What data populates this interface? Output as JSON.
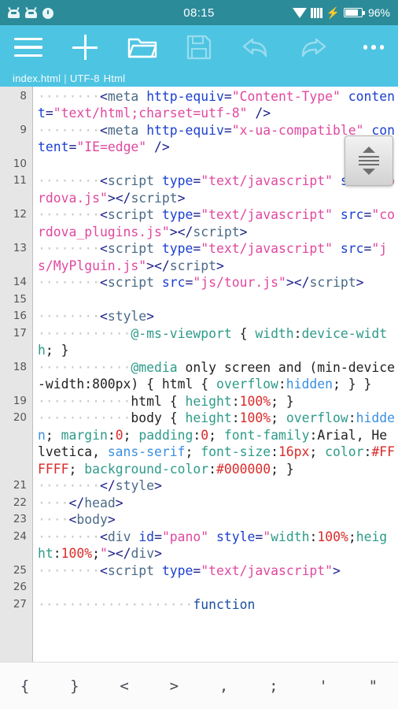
{
  "status_bar": {
    "clock": "08:15",
    "battery_percent": "96%",
    "left_icons": [
      "android-notification-icon",
      "android-notification-icon",
      "alarm-clock-icon"
    ],
    "right_icons": [
      "wifi-icon",
      "signal-bars-icon",
      "charging-bolt-icon",
      "battery-icon"
    ],
    "background_color": "#2c8b99"
  },
  "app_bar": {
    "background_color": "#4dc4e2",
    "buttons": [
      {
        "name": "menu-button",
        "icon": "hamburger-menu-icon",
        "enabled": true
      },
      {
        "name": "new-file-button",
        "icon": "plus-icon",
        "enabled": true
      },
      {
        "name": "open-file-button",
        "icon": "folder-open-icon",
        "enabled": true
      },
      {
        "name": "save-button",
        "icon": "floppy-disk-icon",
        "enabled": false
      },
      {
        "name": "undo-button",
        "icon": "undo-arrow-icon",
        "enabled": false
      },
      {
        "name": "redo-button",
        "icon": "redo-arrow-icon",
        "enabled": false
      },
      {
        "name": "overflow-menu-button",
        "icon": "more-dots-icon",
        "enabled": true
      }
    ],
    "file_info": {
      "filename": "index.html",
      "separator": "|",
      "encoding": "UTF-8",
      "language": "Html"
    }
  },
  "editor": {
    "first_visible_line": 8,
    "last_visible_line": 27,
    "gutter_color": "#e6e6e6",
    "scroll_handle": {
      "name": "scroll-handle",
      "up_icon": "triangle-up-icon",
      "grip_icon": "grip-lines-icon",
      "down_icon": "triangle-down-icon"
    },
    "lines": [
      {
        "number": "8",
        "tokens": [
          {
            "t": "ws",
            "s": "········"
          },
          {
            "t": "pun",
            "s": "<"
          },
          {
            "t": "tag",
            "s": "meta"
          },
          {
            "t": "txt",
            "s": " "
          },
          {
            "t": "attr",
            "s": "http-equiv"
          },
          {
            "t": "pun",
            "s": "="
          },
          {
            "t": "str",
            "s": "\"Content-Type\""
          },
          {
            "t": "txt",
            "s": " "
          },
          {
            "t": "attr",
            "s": "content"
          },
          {
            "t": "pun",
            "s": "="
          },
          {
            "t": "str",
            "s": "\"text/html;charset=utf-8\""
          },
          {
            "t": "txt",
            "s": " "
          },
          {
            "t": "pun",
            "s": "/>"
          }
        ]
      },
      {
        "number": "9",
        "tokens": [
          {
            "t": "ws",
            "s": "········"
          },
          {
            "t": "pun",
            "s": "<"
          },
          {
            "t": "tag",
            "s": "meta"
          },
          {
            "t": "txt",
            "s": " "
          },
          {
            "t": "attr",
            "s": "http-equiv"
          },
          {
            "t": "pun",
            "s": "="
          },
          {
            "t": "str",
            "s": "\"x-ua-compatible\""
          },
          {
            "t": "txt",
            "s": " "
          },
          {
            "t": "attr",
            "s": "content"
          },
          {
            "t": "pun",
            "s": "="
          },
          {
            "t": "str",
            "s": "\"IE=edge\""
          },
          {
            "t": "txt",
            "s": " "
          },
          {
            "t": "pun",
            "s": "/>"
          }
        ]
      },
      {
        "number": "10",
        "tokens": []
      },
      {
        "number": "11",
        "tokens": [
          {
            "t": "ws",
            "s": "········"
          },
          {
            "t": "pun",
            "s": "<"
          },
          {
            "t": "tag",
            "s": "script"
          },
          {
            "t": "txt",
            "s": " "
          },
          {
            "t": "attr",
            "s": "type"
          },
          {
            "t": "pun",
            "s": "="
          },
          {
            "t": "str",
            "s": "\"text/javascript\""
          },
          {
            "t": "txt",
            "s": " "
          },
          {
            "t": "attr",
            "s": "src"
          },
          {
            "t": "pun",
            "s": "="
          },
          {
            "t": "str",
            "s": "\"cordova.js\""
          },
          {
            "t": "pun",
            "s": ">"
          },
          {
            "t": "pun",
            "s": "</"
          },
          {
            "t": "tag",
            "s": "script"
          },
          {
            "t": "pun",
            "s": ">"
          }
        ]
      },
      {
        "number": "12",
        "tokens": [
          {
            "t": "ws",
            "s": "········"
          },
          {
            "t": "pun",
            "s": "<"
          },
          {
            "t": "tag",
            "s": "script"
          },
          {
            "t": "txt",
            "s": " "
          },
          {
            "t": "attr",
            "s": "type"
          },
          {
            "t": "pun",
            "s": "="
          },
          {
            "t": "str",
            "s": "\"text/javascript\""
          },
          {
            "t": "txt",
            "s": " "
          },
          {
            "t": "attr",
            "s": "src"
          },
          {
            "t": "pun",
            "s": "="
          },
          {
            "t": "str",
            "s": "\"cordova_plugins.js\""
          },
          {
            "t": "pun",
            "s": ">"
          },
          {
            "t": "pun",
            "s": "</"
          },
          {
            "t": "tag",
            "s": "script"
          },
          {
            "t": "pun",
            "s": ">"
          }
        ]
      },
      {
        "number": "13",
        "tokens": [
          {
            "t": "ws",
            "s": "········"
          },
          {
            "t": "pun",
            "s": "<"
          },
          {
            "t": "tag",
            "s": "script"
          },
          {
            "t": "txt",
            "s": " "
          },
          {
            "t": "attr",
            "s": "type"
          },
          {
            "t": "pun",
            "s": "="
          },
          {
            "t": "str",
            "s": "\"text/javascript\""
          },
          {
            "t": "txt",
            "s": " "
          },
          {
            "t": "attr",
            "s": "src"
          },
          {
            "t": "pun",
            "s": "="
          },
          {
            "t": "str",
            "s": "\"js/MyPlguin.js\""
          },
          {
            "t": "pun",
            "s": ">"
          },
          {
            "t": "pun",
            "s": "</"
          },
          {
            "t": "tag",
            "s": "script"
          },
          {
            "t": "pun",
            "s": ">"
          }
        ]
      },
      {
        "number": "14",
        "tokens": [
          {
            "t": "ws",
            "s": "········"
          },
          {
            "t": "pun",
            "s": "<"
          },
          {
            "t": "tag",
            "s": "script"
          },
          {
            "t": "txt",
            "s": " "
          },
          {
            "t": "attr",
            "s": "src"
          },
          {
            "t": "pun",
            "s": "="
          },
          {
            "t": "str",
            "s": "\"js/tour.js\""
          },
          {
            "t": "pun",
            "s": ">"
          },
          {
            "t": "pun",
            "s": "</"
          },
          {
            "t": "tag",
            "s": "script"
          },
          {
            "t": "pun",
            "s": ">"
          }
        ]
      },
      {
        "number": "15",
        "tokens": []
      },
      {
        "number": "16",
        "tokens": [
          {
            "t": "ws",
            "s": "········"
          },
          {
            "t": "pun",
            "s": "<"
          },
          {
            "t": "tag",
            "s": "style"
          },
          {
            "t": "pun",
            "s": ">"
          }
        ]
      },
      {
        "number": "17",
        "tokens": [
          {
            "t": "ws",
            "s": "············"
          },
          {
            "t": "at",
            "s": "@-ms-viewport"
          },
          {
            "t": "txt",
            "s": " { "
          },
          {
            "t": "prop",
            "s": "width"
          },
          {
            "t": "txt",
            "s": ":"
          },
          {
            "t": "prop",
            "s": "device-width"
          },
          {
            "t": "txt",
            "s": "; }"
          }
        ]
      },
      {
        "number": "18",
        "tokens": [
          {
            "t": "ws",
            "s": "············"
          },
          {
            "t": "at",
            "s": "@media"
          },
          {
            "t": "txt",
            "s": " only screen and (min-device-width:800px) { html { "
          },
          {
            "t": "prop",
            "s": "overflow"
          },
          {
            "t": "txt",
            "s": ":"
          },
          {
            "t": "val",
            "s": "hidden"
          },
          {
            "t": "txt",
            "s": "; } }"
          }
        ]
      },
      {
        "number": "19",
        "tokens": [
          {
            "t": "ws",
            "s": "············"
          },
          {
            "t": "txt",
            "s": "html { "
          },
          {
            "t": "prop",
            "s": "height"
          },
          {
            "t": "txt",
            "s": ":"
          },
          {
            "t": "num",
            "s": "100%"
          },
          {
            "t": "txt",
            "s": "; }"
          }
        ]
      },
      {
        "number": "20",
        "tokens": [
          {
            "t": "ws",
            "s": "············"
          },
          {
            "t": "txt",
            "s": "body { "
          },
          {
            "t": "prop",
            "s": "height"
          },
          {
            "t": "txt",
            "s": ":"
          },
          {
            "t": "num",
            "s": "100%"
          },
          {
            "t": "txt",
            "s": "; "
          },
          {
            "t": "prop",
            "s": "overflow"
          },
          {
            "t": "txt",
            "s": ":"
          },
          {
            "t": "val",
            "s": "hidden"
          },
          {
            "t": "txt",
            "s": "; "
          },
          {
            "t": "prop",
            "s": "margin"
          },
          {
            "t": "txt",
            "s": ":"
          },
          {
            "t": "num",
            "s": "0"
          },
          {
            "t": "txt",
            "s": "; "
          },
          {
            "t": "prop",
            "s": "padding"
          },
          {
            "t": "txt",
            "s": ":"
          },
          {
            "t": "num",
            "s": "0"
          },
          {
            "t": "txt",
            "s": "; "
          },
          {
            "t": "prop",
            "s": "font-family"
          },
          {
            "t": "txt",
            "s": ":Arial, Helvetica, "
          },
          {
            "t": "val",
            "s": "sans-serif"
          },
          {
            "t": "txt",
            "s": "; "
          },
          {
            "t": "prop",
            "s": "font-size"
          },
          {
            "t": "txt",
            "s": ":"
          },
          {
            "t": "num",
            "s": "16px"
          },
          {
            "t": "txt",
            "s": "; "
          },
          {
            "t": "prop",
            "s": "color"
          },
          {
            "t": "txt",
            "s": ":"
          },
          {
            "t": "num",
            "s": "#FFFFFF"
          },
          {
            "t": "txt",
            "s": "; "
          },
          {
            "t": "prop",
            "s": "background-color"
          },
          {
            "t": "txt",
            "s": ":"
          },
          {
            "t": "num",
            "s": "#000000"
          },
          {
            "t": "txt",
            "s": "; }"
          }
        ]
      },
      {
        "number": "21",
        "tokens": [
          {
            "t": "ws",
            "s": "········"
          },
          {
            "t": "pun",
            "s": "</"
          },
          {
            "t": "tag",
            "s": "style"
          },
          {
            "t": "pun",
            "s": ">"
          }
        ]
      },
      {
        "number": "22",
        "tokens": [
          {
            "t": "ws",
            "s": "····"
          },
          {
            "t": "pun",
            "s": "</"
          },
          {
            "t": "tag",
            "s": "head"
          },
          {
            "t": "pun",
            "s": ">"
          }
        ]
      },
      {
        "number": "23",
        "tokens": [
          {
            "t": "ws",
            "s": "····"
          },
          {
            "t": "pun",
            "s": "<"
          },
          {
            "t": "tag",
            "s": "body"
          },
          {
            "t": "pun",
            "s": ">"
          }
        ]
      },
      {
        "number": "24",
        "tokens": [
          {
            "t": "ws",
            "s": "········"
          },
          {
            "t": "pun",
            "s": "<"
          },
          {
            "t": "tag",
            "s": "div"
          },
          {
            "t": "txt",
            "s": " "
          },
          {
            "t": "attr",
            "s": "id"
          },
          {
            "t": "pun",
            "s": "="
          },
          {
            "t": "str",
            "s": "\"pano\""
          },
          {
            "t": "txt",
            "s": " "
          },
          {
            "t": "attr",
            "s": "style"
          },
          {
            "t": "pun",
            "s": "="
          },
          {
            "t": "str",
            "s": "\""
          },
          {
            "t": "prop",
            "s": "width"
          },
          {
            "t": "txt",
            "s": ":"
          },
          {
            "t": "num",
            "s": "100%"
          },
          {
            "t": "txt",
            "s": ";"
          },
          {
            "t": "prop",
            "s": "height"
          },
          {
            "t": "txt",
            "s": ":"
          },
          {
            "t": "num",
            "s": "100%"
          },
          {
            "t": "txt",
            "s": ";"
          },
          {
            "t": "str",
            "s": "\""
          },
          {
            "t": "pun",
            "s": ">"
          },
          {
            "t": "pun",
            "s": "</"
          },
          {
            "t": "tag",
            "s": "div"
          },
          {
            "t": "pun",
            "s": ">"
          }
        ]
      },
      {
        "number": "25",
        "tokens": [
          {
            "t": "ws",
            "s": "········"
          },
          {
            "t": "pun",
            "s": "<"
          },
          {
            "t": "tag",
            "s": "script"
          },
          {
            "t": "txt",
            "s": " "
          },
          {
            "t": "attr",
            "s": "type"
          },
          {
            "t": "pun",
            "s": "="
          },
          {
            "t": "str",
            "s": "\"text/javascript\""
          },
          {
            "t": "pun",
            "s": ">"
          }
        ]
      },
      {
        "number": "26",
        "tokens": []
      },
      {
        "number": "27",
        "tokens": [
          {
            "t": "ws",
            "s": "····················"
          },
          {
            "t": "kw",
            "s": "function"
          }
        ]
      }
    ]
  },
  "symbol_bar": {
    "symbols": [
      {
        "name": "symbol-brace-open",
        "label": "{"
      },
      {
        "name": "symbol-brace-close",
        "label": "}"
      },
      {
        "name": "symbol-lt",
        "label": "<"
      },
      {
        "name": "symbol-gt",
        "label": ">"
      },
      {
        "name": "symbol-comma",
        "label": ","
      },
      {
        "name": "symbol-semicolon",
        "label": ";"
      },
      {
        "name": "symbol-apostrophe",
        "label": "'"
      },
      {
        "name": "symbol-quote",
        "label": "\""
      }
    ]
  }
}
